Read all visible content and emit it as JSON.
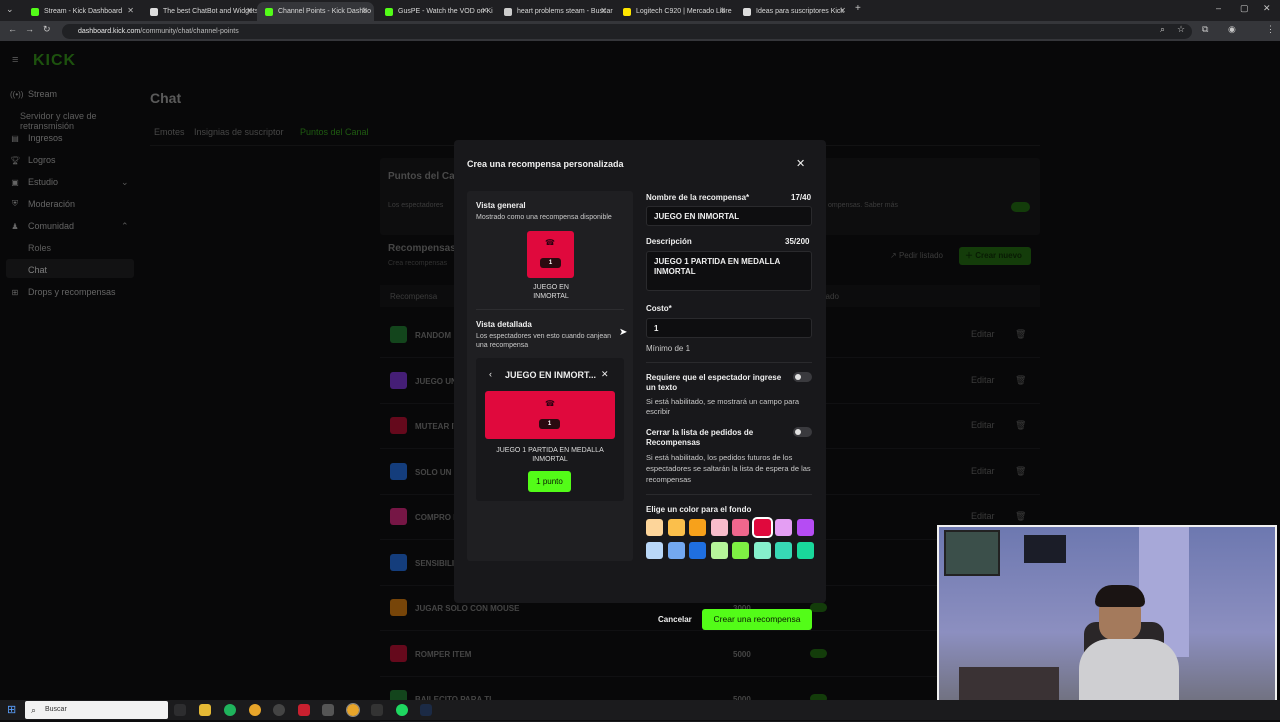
{
  "browser": {
    "tabs": [
      {
        "title": "Stream - Kick Dashboard",
        "color": "#53fc18"
      },
      {
        "title": "The best ChatBot and Widgets",
        "color": "#dddddd"
      },
      {
        "title": "Channel Points - Kick Dashbo",
        "color": "#53fc18"
      },
      {
        "title": "GusPE - Watch the VOD on Ki",
        "color": "#53fc18"
      },
      {
        "title": "heart problems steam - Buscar",
        "color": "#cccccc"
      },
      {
        "title": "Logitech C920 | Mercado Libre",
        "color": "#ffe600"
      },
      {
        "title": "Ideas para suscriptores Kick",
        "color": "#dddddd"
      }
    ],
    "url_host": "dashboard.kick.com",
    "url_path": "/community/chat/channel-points"
  },
  "sidebar": {
    "logo": "KICK",
    "items": [
      {
        "label": "Stream",
        "icon": "broadcast-icon"
      },
      {
        "label": "Servidor y clave de retransmisión",
        "sub": true
      },
      {
        "label": "Ingresos",
        "icon": "wallet-icon"
      },
      {
        "label": "Logros",
        "icon": "trophy-icon"
      },
      {
        "label": "Estudio",
        "icon": "studio-icon"
      },
      {
        "label": "Moderación",
        "icon": "shield-icon"
      },
      {
        "label": "Comunidad",
        "icon": "community-icon"
      },
      {
        "label": "Roles",
        "sub": true
      },
      {
        "label": "Chat",
        "sub": true
      },
      {
        "label": "Drops y recompensas",
        "icon": "gift-icon"
      }
    ]
  },
  "main": {
    "title": "Chat",
    "tabs": [
      "Emotes",
      "Insignias de suscriptor",
      "Puntos del Canal"
    ],
    "panel_title": "Puntos del Canal",
    "panel_desc": "Los espectadores",
    "panel_desc_right": "ompensas. Saber más",
    "rewards_title": "Recompensas",
    "rewards_sub": "Crea recompensas",
    "pedir_listado": "Pedir listado",
    "crear_nuevo": "Crear nuevo",
    "col_reward": "Recompensa",
    "col_enabled": "ilitado",
    "rows": [
      {
        "name": "RANDOM",
        "color": "#1e6b2c",
        "points": "",
        "toggle": false
      },
      {
        "name": "JUEGO UN",
        "color": "#6b2fb5",
        "points": "",
        "toggle": false
      },
      {
        "name": "MUTEAR IT",
        "color": "#9c0e2b",
        "points": "",
        "toggle": false
      },
      {
        "name": "SOLO UN C",
        "color": "#1f5fbf",
        "points": "",
        "toggle": false
      },
      {
        "name": "COMPRO I",
        "color": "#b5226b",
        "points": "",
        "toggle": false
      },
      {
        "name": "SENSIBILI",
        "color": "#1f5fbf",
        "points": "",
        "toggle": false
      },
      {
        "name": "JUGAR SOLO CON MOUSE",
        "color": "#b76b0e",
        "points": "3000",
        "toggle": true
      },
      {
        "name": "ROMPER ITEM",
        "color": "#9c0e2b",
        "points": "5000",
        "toggle": true
      },
      {
        "name": "BAILECITO PARA TI",
        "color": "#1e6b2c",
        "points": "5000",
        "toggle": true
      }
    ],
    "edit_label": "Editar"
  },
  "modal": {
    "title": "Crea una recompensa personalizada",
    "overview_title": "Vista general",
    "overview_sub": "Mostrado como una recompensa disponible",
    "card_cost": "1",
    "card_name": "JUEGO EN INMORTAL",
    "detail_title": "Vista detallada",
    "detail_sub": "Los espectadores ven esto cuando canjean una recompensa",
    "detail_header": "JUEGO EN INMORT...",
    "detail_desc": "JUEGO 1 PARTIDA EN MEDALLA INMORTAL",
    "detail_button": "1 punto",
    "name_label": "Nombre de la recompensa*",
    "name_count": "17/40",
    "name_value": "JUEGO EN INMORTAL",
    "desc_label": "Descripción",
    "desc_count": "35/200",
    "desc_value": "JUEGO 1 PARTIDA EN MEDALLA INMORTAL",
    "cost_label": "Costo*",
    "cost_value": "1",
    "cost_hint": "Mínimo de 1",
    "req_text_label": "Requiere que el espectador ingrese un texto",
    "req_text_hint": "Si está habilitado, se mostrará un campo para escribir",
    "close_list_label": "Cerrar la lista de pedidos de Recompensas",
    "close_list_hint": "Si está habilitado, los pedidos futuros de los espectadores se saltarán la lista de espera de las recompensas",
    "color_label": "Elige un color para el fondo",
    "colors": [
      "#fdd59a",
      "#fbbf4b",
      "#f7a11b",
      "#f8bccb",
      "#f0678d",
      "#e0093d",
      "#e49ef3",
      "#b54cf3",
      "#b9d7f8",
      "#73a8f0",
      "#1f6fe0",
      "#b6f59a",
      "#7ef043",
      "#86f0cc",
      "#37d8b5",
      "#19d89b"
    ],
    "selected_color": "#e0093d",
    "cancel_label": "Cancelar",
    "create_label": "Crear una recompensa",
    "accent": "#53fc18"
  },
  "taskbar": {
    "search_placeholder": "Buscar"
  }
}
